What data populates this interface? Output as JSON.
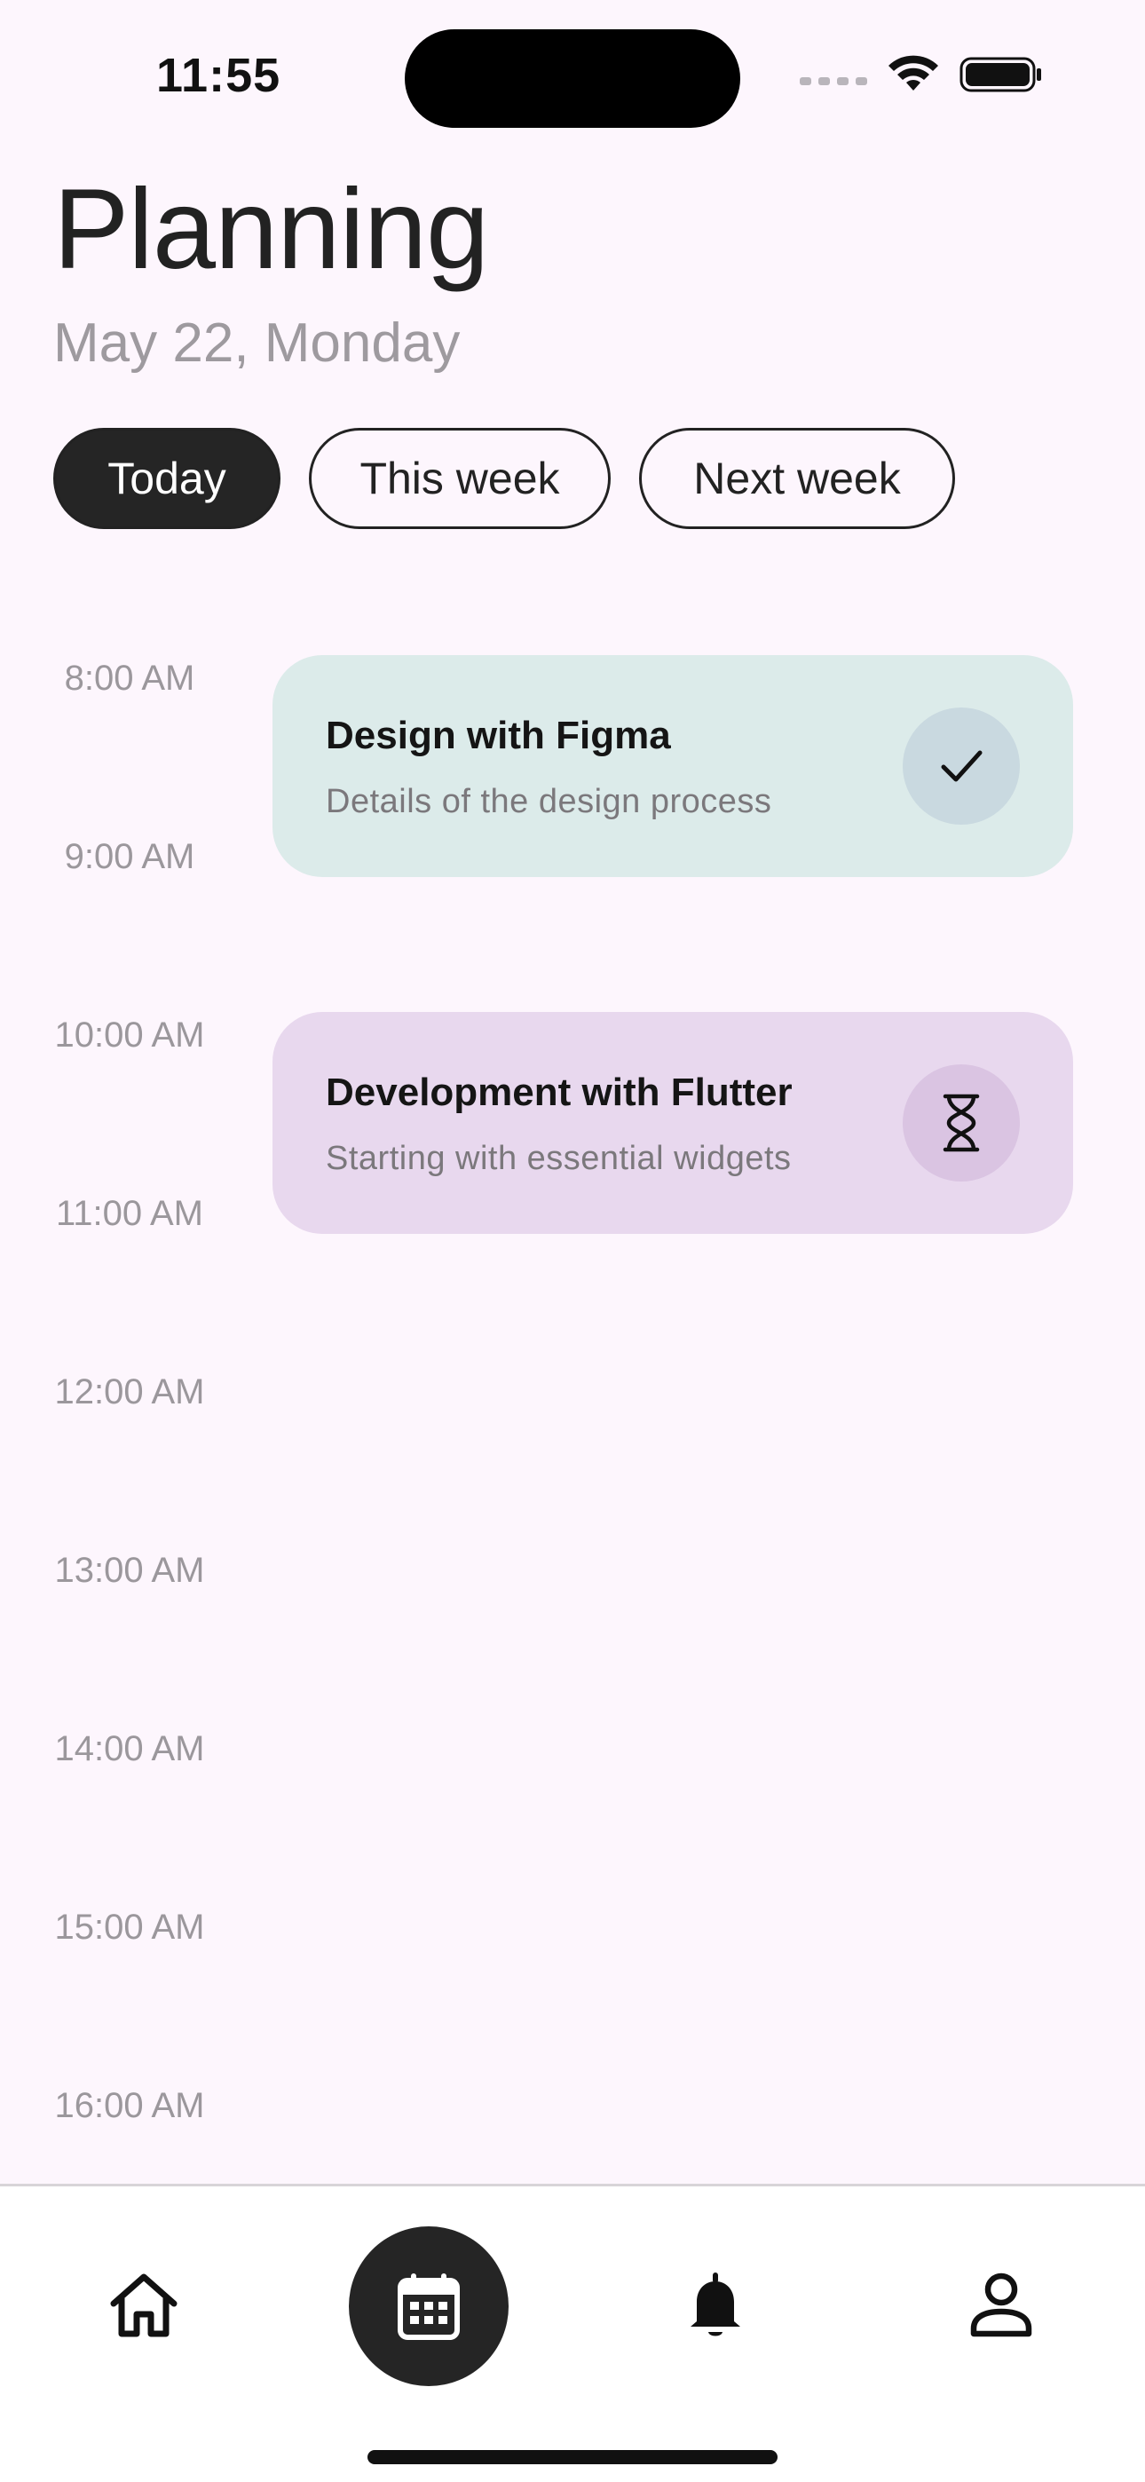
{
  "status_bar": {
    "time": "11:55"
  },
  "header": {
    "title": "Planning",
    "date": "May 22, Monday"
  },
  "filters": [
    {
      "label": "Today",
      "active": true
    },
    {
      "label": "This week",
      "active": false
    },
    {
      "label": "Next week",
      "active": false
    }
  ],
  "timeline": {
    "hours": [
      "8:00 AM",
      "9:00 AM",
      "10:00 AM",
      "11:00 AM",
      "12:00 AM",
      "13:00 AM",
      "14:00 AM",
      "15:00 AM",
      "16:00 AM"
    ]
  },
  "events": [
    {
      "title": "Design with Figma",
      "description": "Details of the design process",
      "status_icon": "check-icon",
      "color": "#dcebea",
      "icon_bg": "#c9d9e0"
    },
    {
      "title": "Development with Flutter",
      "description": "Starting with essential widgets",
      "status_icon": "hourglass-icon",
      "color": "#e8d8ee",
      "icon_bg": "#dac4e2"
    }
  ],
  "bottom_nav": {
    "items": [
      {
        "icon": "home-icon",
        "selected": false
      },
      {
        "icon": "calendar-icon",
        "selected": true
      },
      {
        "icon": "bell-icon",
        "selected": false
      },
      {
        "icon": "profile-icon",
        "selected": false
      }
    ]
  },
  "colors": {
    "background": "#fdf6fd",
    "accent_dark": "#252525",
    "muted_text": "#9e9a9f"
  }
}
